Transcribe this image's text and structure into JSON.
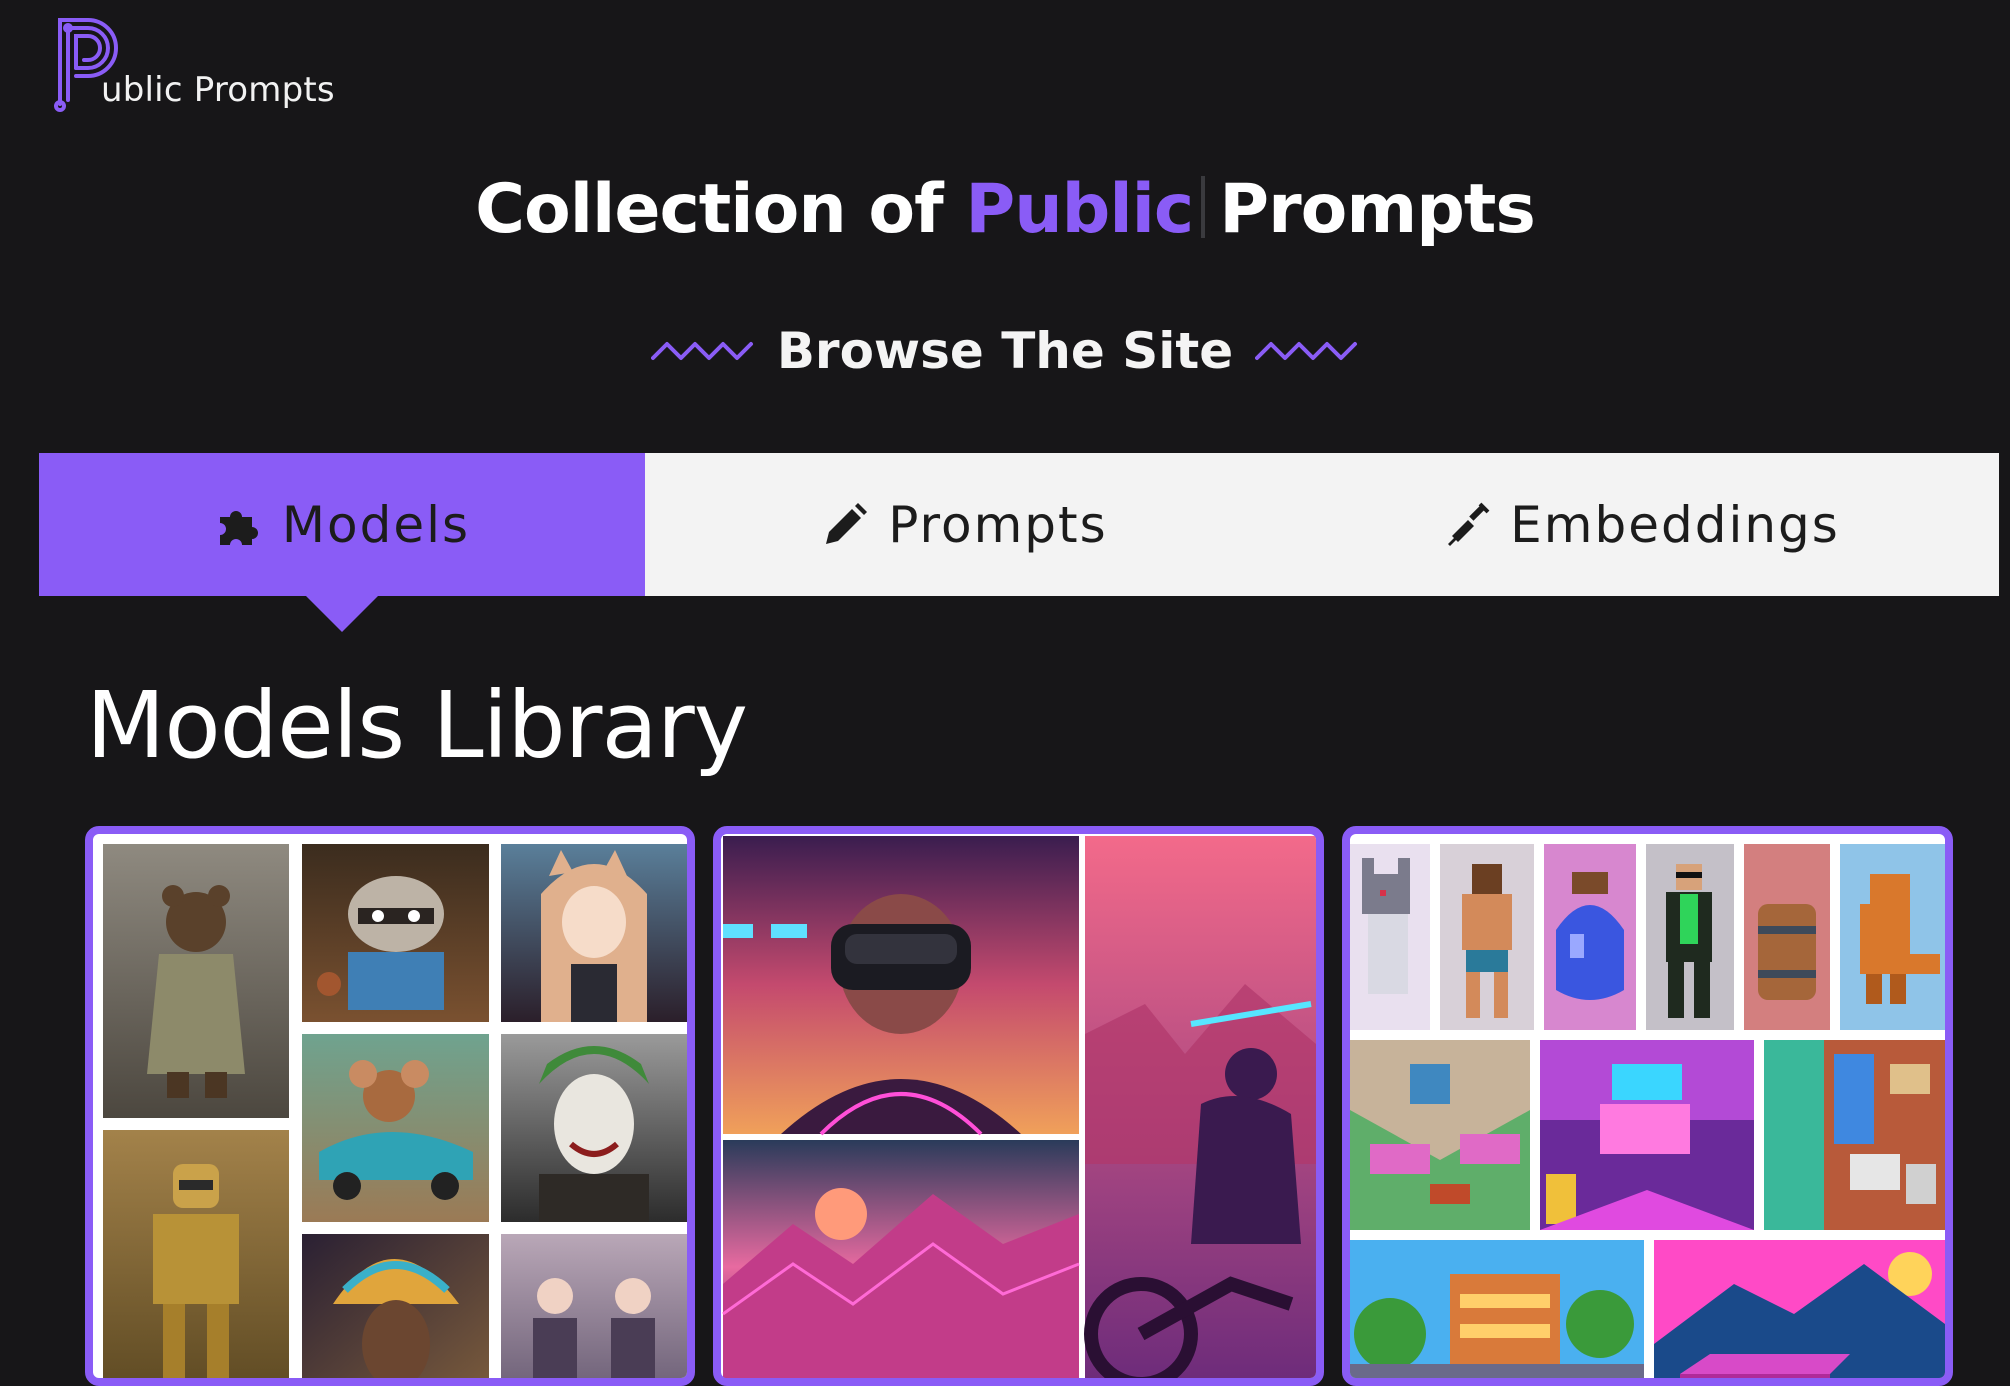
{
  "logo": {
    "letter": "P",
    "text": "ublic Prompts",
    "icon": "circuit-p-logo-icon"
  },
  "headline": {
    "part1": "Collection of ",
    "accent": "Public",
    "part2": "Prompts"
  },
  "browse": {
    "label": "Browse The Site",
    "ornament": "zigzag-icon"
  },
  "tabs": [
    {
      "label": "Models",
      "icon": "puzzle-piece-icon",
      "active": true
    },
    {
      "label": "Prompts",
      "icon": "pencil-icon",
      "active": false
    },
    {
      "label": "Embeddings",
      "icon": "syringe-icon",
      "active": false
    }
  ],
  "section": {
    "title": "Models Library"
  },
  "cards": [
    {
      "tiles": [
        "teddy-bear-in-trench-coat",
        "raccoon-in-cafe",
        "anime-cat-girl",
        "cartoon-mouse-in-car",
        "joker-portrait",
        "golden-robot",
        "colorful-woman-portrait",
        "two-girls-street"
      ]
    },
    {
      "tiles": [
        "man-with-vr-headset",
        "synthwave-motorcyclist",
        "synthwave-mountain-sunset"
      ]
    },
    {
      "tiles": [
        "pixel-cat",
        "pixel-warrior",
        "pixel-potion",
        "pixel-agent",
        "pixel-barrel",
        "pixel-dinosaur",
        "pixel-living-room",
        "pixel-neon-room",
        "pixel-bathroom",
        "pixel-house-trees",
        "pixel-car-mountain"
      ]
    }
  ],
  "colors": {
    "background": "#171618",
    "accent": "#8a5cf6",
    "tabbar": "#f3f3f3",
    "text": "#ffffff"
  }
}
